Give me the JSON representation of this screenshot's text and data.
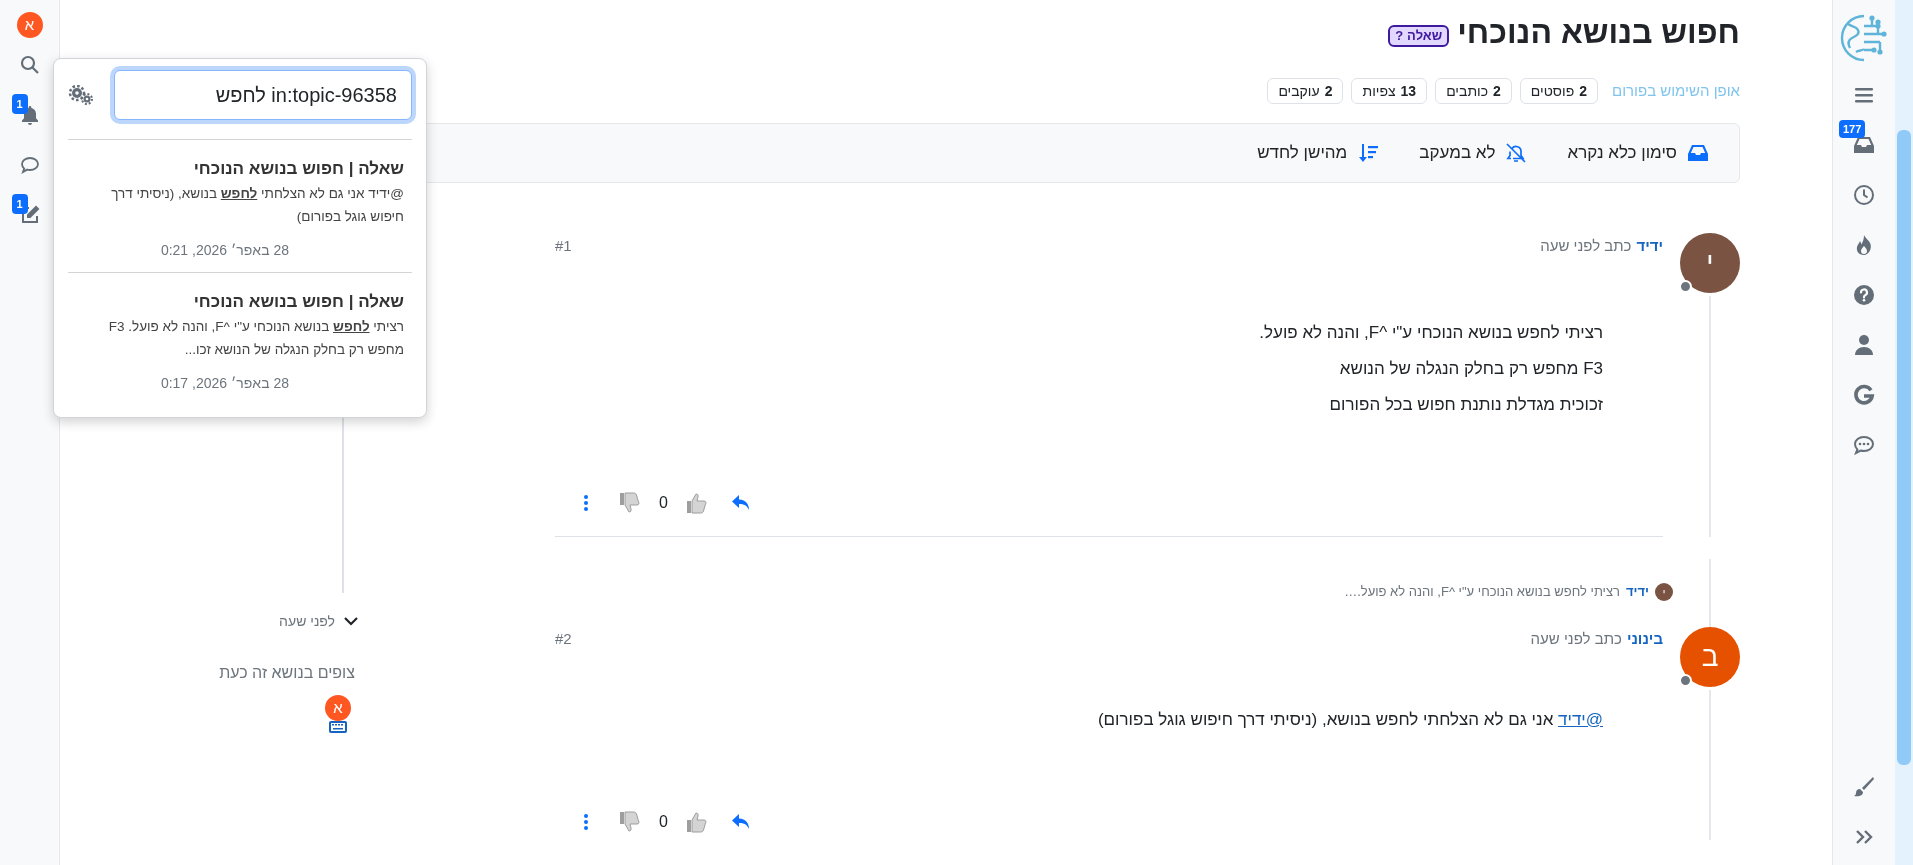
{
  "left_rail": {
    "avatar": {
      "letter": "א",
      "color": "#ff5722"
    },
    "notifications_badge": "1",
    "drafts_badge": "1"
  },
  "search_popup": {
    "query": "in:topic-96358 לחפש",
    "results": [
      {
        "title": "שאלה | חפוש בנושא הנוכחי",
        "snippet": "@ידיד אני גם לא הצלחתי **לחפש** בנושא, (ניסיתי דרך חיפוש גוגל בפורום)",
        "date": "28 באפר׳ 2026, 0:21"
      },
      {
        "title": "שאלה | חפוש בנושא הנוכחי",
        "snippet": "רציתי **לחפש** בנושא הנוכחי ע\"י ^F, והנה לא פועל. F3 מחפש רק בחלק הנגלה של הנושא זכו...",
        "date": "28 באפר׳ 2026, 0:17"
      }
    ]
  },
  "topic": {
    "title": "חפוש בנושא הנוכחי",
    "tag": {
      "mark": "?",
      "label": "שאלה"
    },
    "category": "אופן השימוש בפורום",
    "stats": [
      {
        "value": "2",
        "label": "פוסטים"
      },
      {
        "value": "2",
        "label": "כותבים"
      },
      {
        "value": "13",
        "label": "צפיות"
      },
      {
        "value": "2",
        "label": "עוקבים"
      }
    ]
  },
  "toolbar": [
    {
      "label": "סימון כלא נקרא"
    },
    {
      "label": "לא במעקב"
    },
    {
      "label": "מהישן לחדש"
    }
  ],
  "posts": [
    {
      "avatar": {
        "letter": "י",
        "color": "#7b5343"
      },
      "author": "ידיד",
      "time": "כתב לפני שעה",
      "number": "#1",
      "paragraphs": [
        "רציתי לחפש בנושא הנוכחי ע\"י ^F, והנה לא פועל.",
        "F3 מחפש רק בחלק הנגלה של הנושא",
        "זכוכית מגדלת נותנת חפוש בכל הפורום"
      ],
      "votes": "0"
    },
    {
      "reply_to": {
        "avatar": {
          "letter": "י",
          "color": "#7b5343"
        },
        "author": "ידיד",
        "excerpt": "רציתי לחפש בנושא הנוכחי ע\"י ^F, והנה לא פועל.…"
      },
      "avatar": {
        "letter": "ב",
        "color": "#e65100"
      },
      "author": "בינוני",
      "time": "כתב לפני שעה",
      "number": "#2",
      "mention": "@ידיד",
      "paragraphs": [
        "אני גם לא הצלחתי לחפש בנושא, (ניסיתי דרך חיפוש גוגל בפורום)"
      ],
      "votes": "0"
    }
  ],
  "timeline": {
    "time": "לפני שעה"
  },
  "watchers": {
    "title": "צופים בנושא זה כעת",
    "users": [
      {
        "letter": "א",
        "color": "#ff5722"
      }
    ]
  },
  "right_rail": {
    "inbox_badge": "177"
  }
}
